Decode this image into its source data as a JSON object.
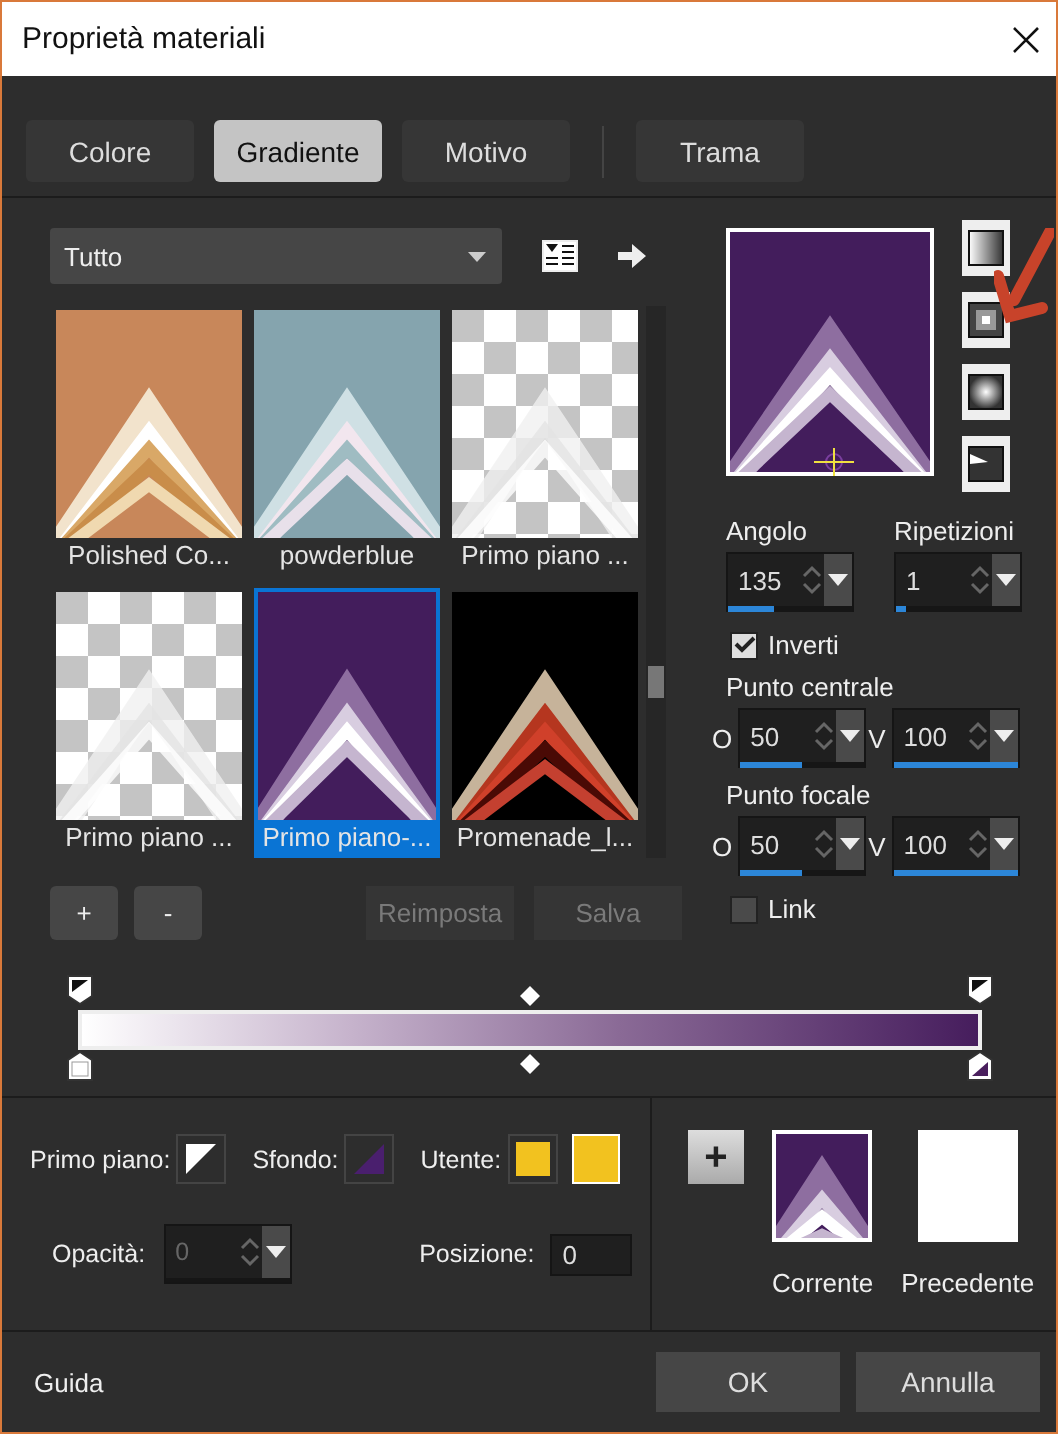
{
  "window": {
    "title": "Proprietà materiali"
  },
  "tabs": [
    {
      "label": "Colore",
      "selected": false
    },
    {
      "label": "Gradiente",
      "selected": true
    },
    {
      "label": "Motivo",
      "selected": false
    },
    {
      "label": "Trama",
      "selected": false
    }
  ],
  "category": {
    "value": "Tutto"
  },
  "gradients": [
    {
      "name": "Polished Co...",
      "kind": "copper",
      "selected": false
    },
    {
      "name": "powderblue",
      "kind": "powderblue",
      "selected": false
    },
    {
      "name": "Primo piano ...",
      "kind": "transparent",
      "selected": false
    },
    {
      "name": "Primo piano ...",
      "kind": "transparent",
      "selected": false
    },
    {
      "name": "Primo piano-...",
      "kind": "purple",
      "selected": true
    },
    {
      "name": "Promenade_l...",
      "kind": "promenade",
      "selected": false
    }
  ],
  "list_buttons": [
    "+",
    "-"
  ],
  "action_buttons": [
    {
      "label": "Reimposta",
      "disabled": true
    },
    {
      "label": "Salva",
      "disabled": true
    }
  ],
  "style_buttons": [
    {
      "kind": "linear"
    },
    {
      "kind": "rectangular"
    },
    {
      "kind": "radial"
    },
    {
      "kind": "sunburst"
    }
  ],
  "angle": {
    "label": "Angolo",
    "value": "135",
    "level": 0.37
  },
  "repeats": {
    "label": "Ripetizioni",
    "value": "1",
    "level": 0.08
  },
  "invert": {
    "label": "Inverti",
    "checked": true
  },
  "center": {
    "label": "Punto centrale",
    "h": {
      "prefix": "O",
      "value": "50",
      "level": 0.5
    },
    "v": {
      "prefix": "V",
      "value": "100",
      "level": 1
    }
  },
  "focal": {
    "label": "Punto focale",
    "h": {
      "prefix": "O",
      "value": "50",
      "level": 0.5
    },
    "v": {
      "prefix": "V",
      "value": "100",
      "level": 1
    }
  },
  "link": {
    "label": "Link",
    "checked": false
  },
  "swatches": {
    "foreground": "Primo piano:",
    "background": "Sfondo:",
    "user": "Utente:"
  },
  "opacity": {
    "label": "Opacità:",
    "value": "0",
    "disabled": true
  },
  "position": {
    "label": "Posizione:",
    "value": "0"
  },
  "compare": {
    "add": "+",
    "current": "Corrente",
    "previous": "Precedente"
  },
  "footer": {
    "help": "Guida",
    "buttons": [
      "OK",
      "Annulla"
    ]
  }
}
